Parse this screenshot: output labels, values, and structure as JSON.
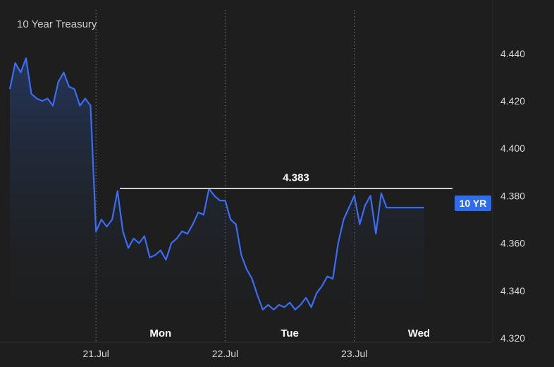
{
  "chart_data": {
    "type": "area",
    "title": "10 Year Treasury",
    "series_label": "10 YR",
    "ylim": [
      4.32,
      4.445
    ],
    "y_ticks": [
      "4.440",
      "4.420",
      "4.400",
      "4.380",
      "4.360",
      "4.340",
      "4.320"
    ],
    "y_tick_values": [
      4.44,
      4.42,
      4.4,
      4.38,
      4.36,
      4.34,
      4.32
    ],
    "date_labels": [
      "21.Jul",
      "22.Jul",
      "23.Jul"
    ],
    "day_labels": [
      "Mon",
      "Tue",
      "Wed"
    ],
    "reference_line": {
      "value": 4.383,
      "label": "4.383"
    },
    "grid": false,
    "series": [
      {
        "name": "10 YR",
        "x": [
          "18.Jul 08:00",
          "18.Jul 09:00",
          "18.Jul 10:00",
          "18.Jul 11:00",
          "18.Jul 12:00",
          "18.Jul 13:00",
          "18.Jul 14:00",
          "18.Jul 15:00",
          "18.Jul 16:00",
          "18.Jul 17:00",
          "18.Jul 18:00",
          "18.Jul 19:00",
          "18.Jul 20:00",
          "18.Jul 21:00",
          "18.Jul 22:00",
          "18.Jul 23:00",
          "21.Jul 00:00",
          "21.Jul 01:00",
          "21.Jul 02:00",
          "21.Jul 03:00",
          "21.Jul 04:00",
          "21.Jul 05:00",
          "21.Jul 06:00",
          "21.Jul 07:00",
          "21.Jul 08:00",
          "21.Jul 09:00",
          "21.Jul 10:00",
          "21.Jul 11:00",
          "21.Jul 12:00",
          "21.Jul 13:00",
          "21.Jul 14:00",
          "21.Jul 15:00",
          "21.Jul 16:00",
          "21.Jul 17:00",
          "21.Jul 18:00",
          "21.Jul 19:00",
          "21.Jul 20:00",
          "21.Jul 21:00",
          "21.Jul 22:00",
          "21.Jul 23:00",
          "22.Jul 00:00",
          "22.Jul 01:00",
          "22.Jul 02:00",
          "22.Jul 03:00",
          "22.Jul 04:00",
          "22.Jul 05:00",
          "22.Jul 06:00",
          "22.Jul 07:00",
          "22.Jul 08:00",
          "22.Jul 09:00",
          "22.Jul 10:00",
          "22.Jul 11:00",
          "22.Jul 12:00",
          "22.Jul 13:00",
          "22.Jul 14:00",
          "22.Jul 15:00",
          "22.Jul 16:00",
          "22.Jul 17:00",
          "22.Jul 18:00",
          "22.Jul 19:00",
          "22.Jul 20:00",
          "22.Jul 21:00",
          "22.Jul 22:00",
          "22.Jul 23:00",
          "23.Jul 00:00",
          "23.Jul 01:00",
          "23.Jul 02:00",
          "23.Jul 03:00",
          "23.Jul 04:00",
          "23.Jul 05:00",
          "23.Jul 06:00",
          "23.Jul 07:00",
          "23.Jul 08:00",
          "23.Jul 09:00",
          "23.Jul 10:00",
          "23.Jul 11:00",
          "23.Jul 12:00",
          "23.Jul 13:00"
        ],
        "values": [
          4.425,
          4.436,
          4.432,
          4.438,
          4.423,
          4.421,
          4.42,
          4.421,
          4.418,
          4.428,
          4.432,
          4.426,
          4.425,
          4.418,
          4.421,
          4.418,
          4.365,
          4.37,
          4.367,
          4.37,
          4.382,
          4.365,
          4.358,
          4.362,
          4.36,
          4.363,
          4.354,
          4.355,
          4.357,
          4.353,
          4.36,
          4.362,
          4.365,
          4.364,
          4.368,
          4.373,
          4.372,
          4.383,
          4.38,
          4.378,
          4.378,
          4.37,
          4.368,
          4.355,
          4.349,
          4.345,
          4.338,
          4.332,
          4.334,
          4.332,
          4.334,
          4.333,
          4.335,
          4.332,
          4.334,
          4.337,
          4.333,
          4.339,
          4.342,
          4.346,
          4.345,
          4.36,
          4.37,
          4.375,
          4.38,
          4.368,
          4.376,
          4.38,
          4.364,
          4.381,
          4.375,
          4.375,
          4.375,
          4.375,
          4.375,
          4.375,
          4.375,
          4.375
        ]
      }
    ]
  }
}
